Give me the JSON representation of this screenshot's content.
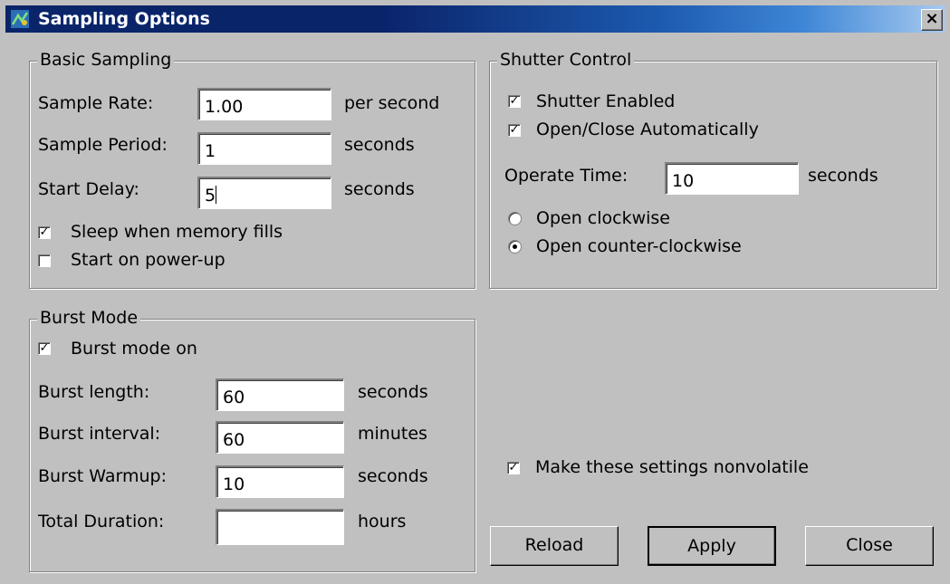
{
  "window": {
    "title": "Sampling Options",
    "close_glyph": "×"
  },
  "basic": {
    "legend": "Basic Sampling",
    "rate_label": "Sample Rate:",
    "rate_value": "1.00",
    "rate_unit": "per second",
    "period_label": "Sample Period:",
    "period_value": "1",
    "period_unit": "seconds",
    "delay_label": "Start Delay:",
    "delay_value": "5",
    "delay_unit": "seconds",
    "sleep_label": "Sleep when memory fills",
    "sleep_checked": true,
    "powerup_label": "Start on power-up",
    "powerup_checked": false
  },
  "shutter": {
    "legend": "Shutter Control",
    "enabled_label": "Shutter Enabled",
    "enabled_checked": true,
    "auto_label": "Open/Close Automatically",
    "auto_checked": true,
    "operate_label": "Operate Time:",
    "operate_value": "10",
    "operate_unit": "seconds",
    "cw_label": "Open clockwise",
    "ccw_label": "Open counter-clockwise",
    "selected_direction": "counter-clockwise"
  },
  "burst": {
    "legend": "Burst Mode",
    "on_label": "Burst mode on",
    "on_checked": true,
    "length_label": "Burst length:",
    "length_value": "60",
    "length_unit": "seconds",
    "interval_label": "Burst interval:",
    "interval_value": "60",
    "interval_unit": "minutes",
    "warmup_label": "Burst Warmup:",
    "warmup_value": "10",
    "warmup_unit": "seconds",
    "duration_label": "Total Duration:",
    "duration_value": "",
    "duration_unit": "hours"
  },
  "nonvolatile": {
    "label": "Make these settings nonvolatile",
    "checked": true
  },
  "buttons": {
    "reload": "Reload",
    "apply": "Apply",
    "close": "Close"
  },
  "check_glyph": "✓",
  "colors": {
    "title_start": "#0a246a",
    "title_end": "#a6caf0",
    "face": "#c0c0c0"
  }
}
